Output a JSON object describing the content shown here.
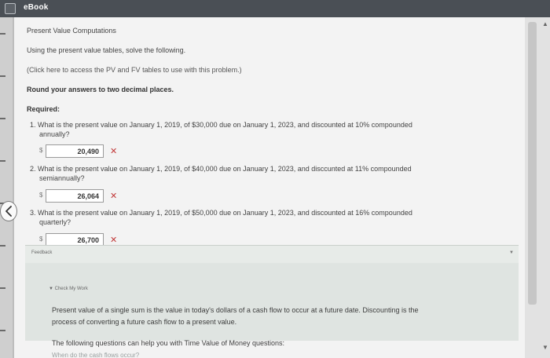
{
  "window": {
    "title": "eBook"
  },
  "problem": {
    "title": "Present Value Computations",
    "instruction": "Using the present value tables, solve the following.",
    "tables_link": "(Click here to access the PV and FV tables to use with this problem.)",
    "rounding": "Round your answers to two decimal places.",
    "required_label": "Required:"
  },
  "questions": [
    {
      "line1": "1. What is the present value on January 1, 2019, of $30,000 due on January 1, 2023, and discounted at 10% compounded",
      "line2": "annually?",
      "currency": "$",
      "answer": "20,490",
      "status_mark": "✕"
    },
    {
      "line1": "2. What is the present value on January 1, 2019, of $40,000 due on January 1, 2023, and disccunted at 11% compounded",
      "line2": "semiannually?",
      "currency": "$",
      "answer": "26,064",
      "status_mark": "✕"
    },
    {
      "line1": "3. What is the present value on January 1, 2019, of $50,000 due on January 1, 2023, and discounted at 16% compounded",
      "line2": "quarterly?",
      "currency": "$",
      "answer": "26,700",
      "status_mark": "✕"
    }
  ],
  "feedback": {
    "header": "Feedback",
    "toggle": "▼",
    "check_my_work": "▼ Check My Work",
    "para1_line1": "Present value of a single sum is the value in today's dollars of a cash flow to occur at a future date. Discounting is the",
    "para1_line2": "process of converting a future cash flow to a present value.",
    "para2": "The following questions can help you with Time Value of Money questions:",
    "para3_partial": "When do the cash flows occur?"
  }
}
